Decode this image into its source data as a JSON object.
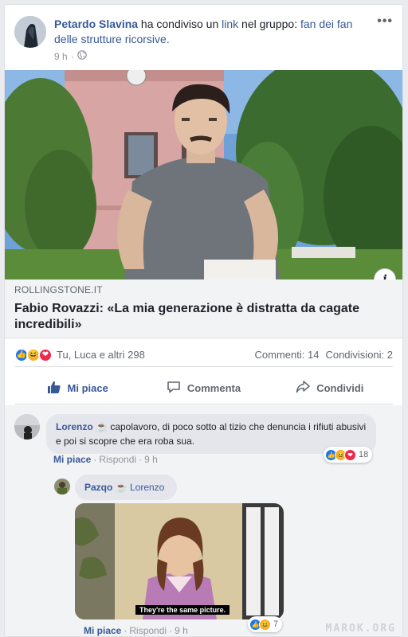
{
  "post": {
    "author": "Petardo Slavina",
    "action_text": " ha condiviso un ",
    "link_word": "link",
    "group_prefix": " nel gruppo: ",
    "group_name": "fan dei fan delle strutture ricorsive.",
    "time": "9 h",
    "privacy_icon": "globe-icon",
    "more_icon": "more-options-icon",
    "link": {
      "domain": "ROLLINGSTONE.IT",
      "title": "Fabio Rovazzi: «La mia generazione è distratta da cagate incredibili»"
    },
    "stats": {
      "reactions": [
        "like",
        "haha",
        "love"
      ],
      "names": "Tu, Luca e altri 298",
      "comments": "Commenti: 14",
      "shares": "Condivisioni: 2"
    },
    "actions": {
      "like": "Mi piace",
      "comment": "Commenta",
      "share": "Condividi"
    }
  },
  "comments": [
    {
      "author": "Lorenzo",
      "text": "capolavoro, di poco sotto al tizio che denuncia i rifiuti abusivi e poi si scopre che era roba sua.",
      "like": "Mi piace",
      "reply": "Rispondi",
      "time": "9 h",
      "reaction_count": "18"
    },
    {
      "author": "Pazqo",
      "mention": "Lorenzo",
      "gif_caption": "They're the same picture.",
      "like": "Mi piace",
      "reply": "Rispondi",
      "time": "9 h",
      "reaction_count": "7"
    }
  ],
  "watermark": "MAROK.ORG",
  "colors": {
    "link_blue": "#385898",
    "like_blue": "#1877f2",
    "love_red": "#f0284a",
    "haha_yellow": "#f7b125"
  }
}
